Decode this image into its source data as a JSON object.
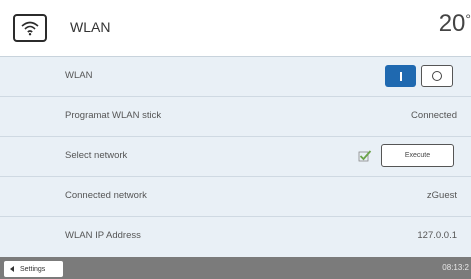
{
  "header": {
    "icon": "wifi-icon",
    "title": "WLAN",
    "temperature": "20",
    "temperature_unit": "°"
  },
  "rows": [
    {
      "label": "WLAN",
      "control": "toggle",
      "state": "on",
      "on_label": "I",
      "off_label": "O"
    },
    {
      "label": "Programat WLAN stick",
      "value": "Connected"
    },
    {
      "label": "Select network",
      "button_label": "Execute",
      "status_icon": "check-icon"
    },
    {
      "label": "Connected network",
      "value": "zGuest"
    },
    {
      "label": "WLAN IP Address",
      "value": "127.0.0.1"
    }
  ],
  "footer": {
    "back_label": "Settings",
    "time": "08:13:2"
  },
  "colors": {
    "accent": "#1f69b0",
    "row_background": "#e9f0f6",
    "footer": "#7b7b7b",
    "check": "#6ba34a"
  }
}
